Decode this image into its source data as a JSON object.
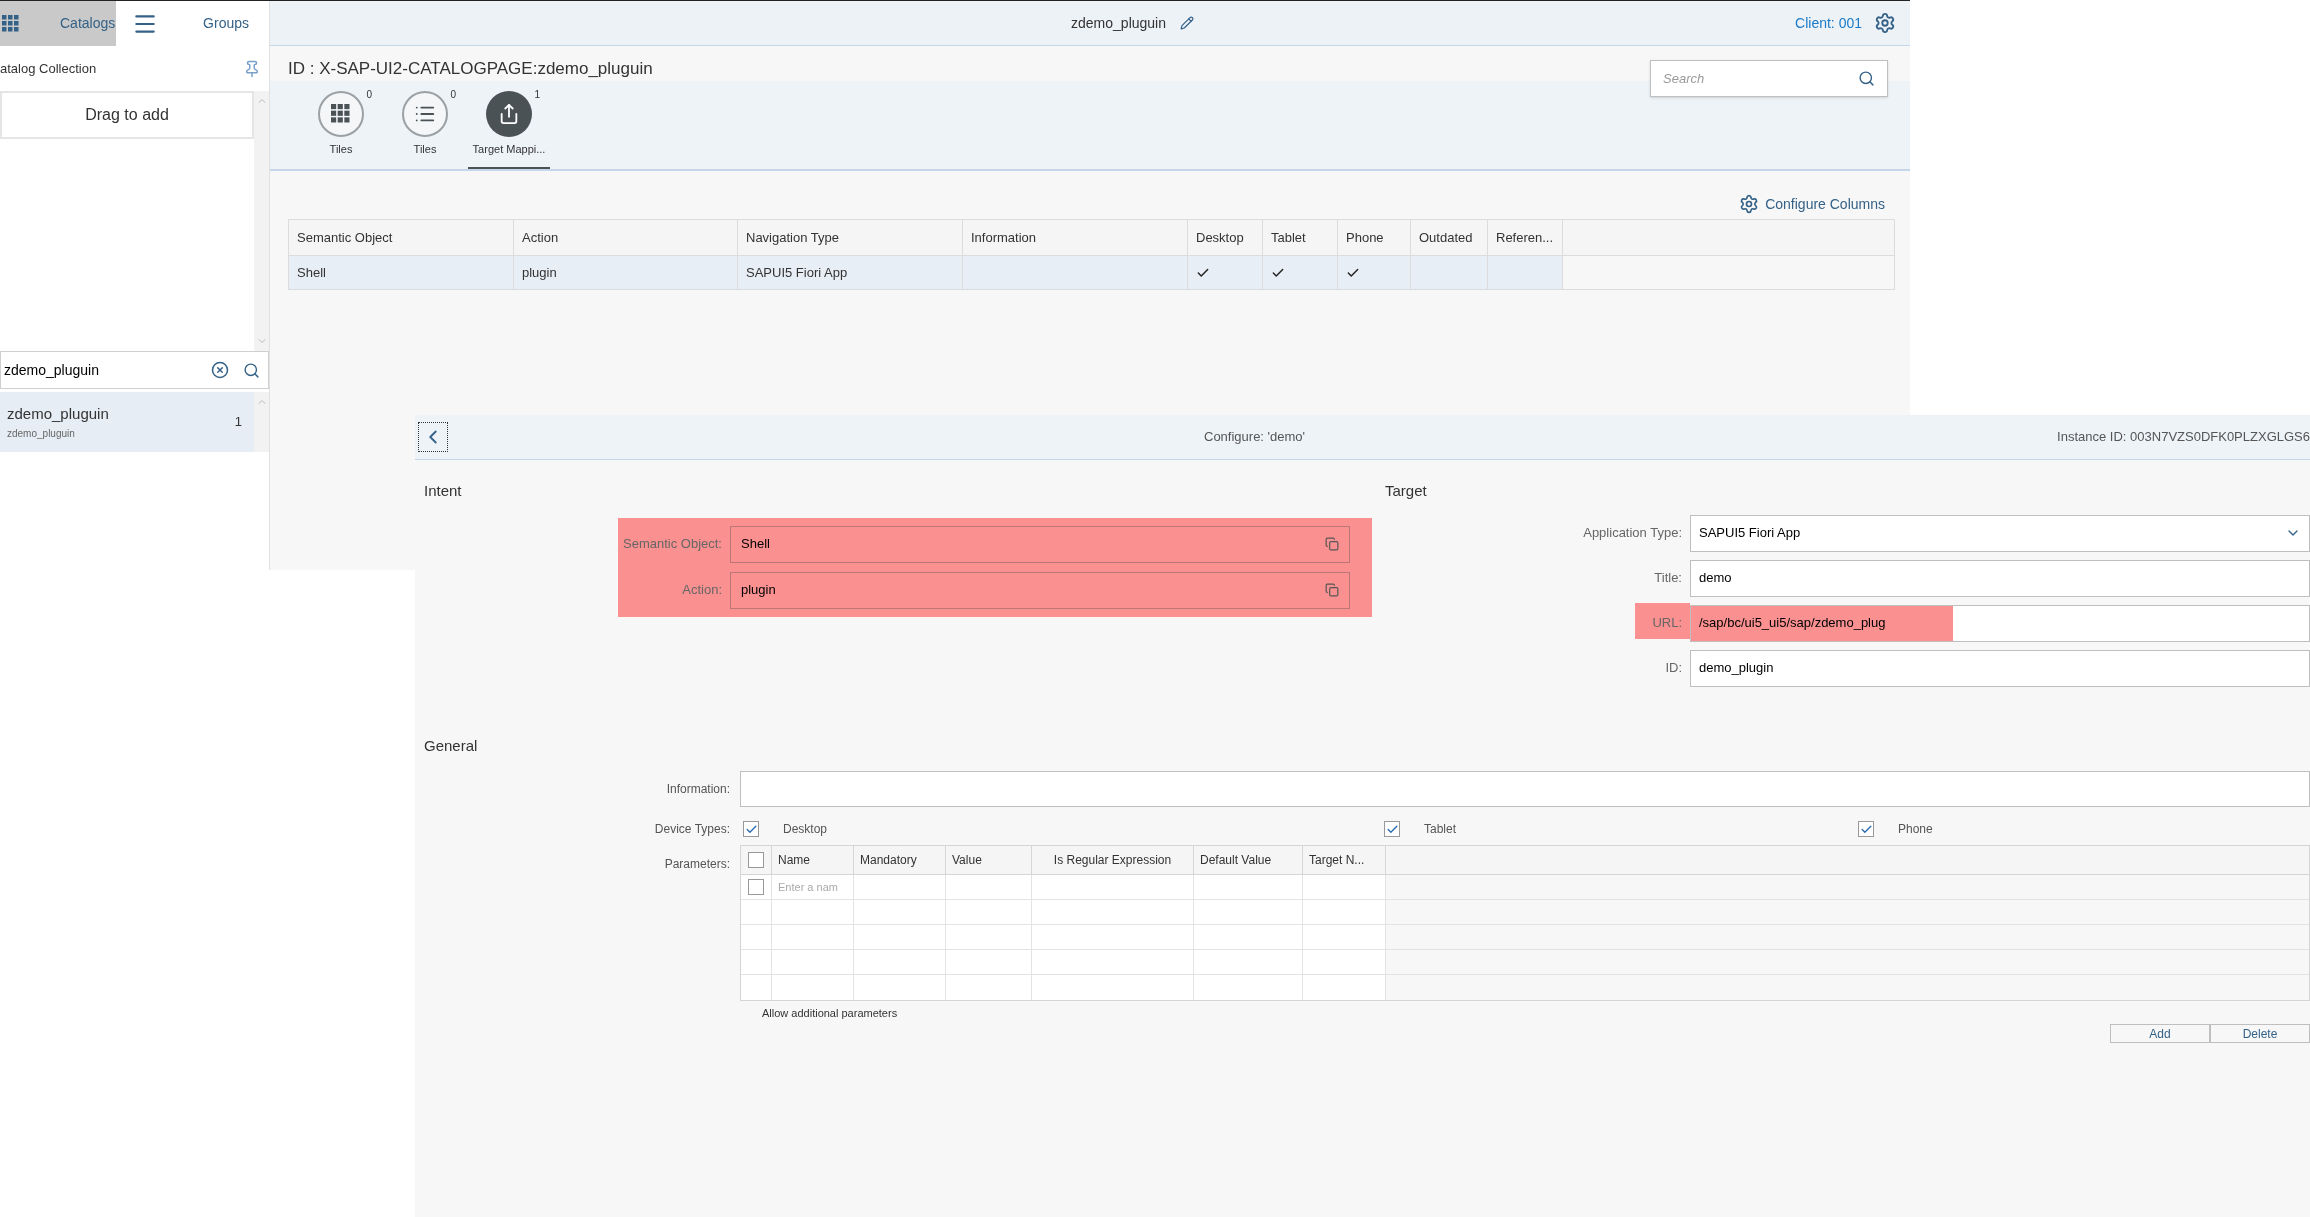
{
  "catalog_window": {
    "sidebar": {
      "tabs": [
        {
          "label": "Catalogs",
          "selected": true
        },
        {
          "label": "Groups",
          "selected": false
        }
      ],
      "collection_title": "atalog Collection",
      "drop_zone": "Drag to add",
      "search": {
        "value": "zdemo_pluguin"
      },
      "items": [
        {
          "title": "zdemo_pluguin",
          "subtitle": "zdemo_pluguin",
          "count": "1",
          "selected": true
        }
      ]
    },
    "header": {
      "title": "zdemo_pluguin",
      "client": "Client: 001"
    },
    "page_id": "ID : X-SAP-UI2-CATALOGPAGE:zdemo_pluguin",
    "search": {
      "placeholder": "Search"
    },
    "content_tabs": [
      {
        "kind": "grid",
        "label": "Tiles",
        "count": "0",
        "selected": false
      },
      {
        "kind": "list",
        "label": "Tiles",
        "count": "0",
        "selected": false
      },
      {
        "kind": "mapping",
        "label": "Target Mappi...",
        "count": "1",
        "selected": true
      }
    ],
    "configure_columns": "Configure Columns",
    "table": {
      "columns": [
        "Semantic Object",
        "Action",
        "Navigation Type",
        "Information",
        "Desktop",
        "Tablet",
        "Phone",
        "Outdated",
        "Referen..."
      ],
      "rows": [
        {
          "semantic_object": "Shell",
          "action": "plugin",
          "navigation_type": "SAPUI5 Fiori App",
          "desktop": true,
          "tablet": true,
          "phone": true,
          "selected": true
        }
      ]
    }
  },
  "configure_window": {
    "title": "Configure: 'demo'",
    "instance_id": "Instance ID: 003N7VZS0DFK0PLZXGLGS6",
    "intent": {
      "heading": "Intent",
      "highlighted": true,
      "fields": [
        {
          "label": "Semantic Object:",
          "value": "Shell"
        },
        {
          "label": "Action:",
          "value": "plugin"
        }
      ]
    },
    "target": {
      "heading": "Target",
      "fields": [
        {
          "kind": "select",
          "label": "Application Type:",
          "value": "SAPUI5 Fiori App",
          "highlighted": false
        },
        {
          "kind": "text",
          "label": "Title:",
          "value": "demo",
          "highlighted": false
        },
        {
          "kind": "text",
          "label": "URL:",
          "value": "/sap/bc/ui5_ui5/sap/zdemo_plug",
          "highlighted": true
        },
        {
          "kind": "text",
          "label": "ID:",
          "value": "demo_plugin",
          "highlighted": false
        }
      ]
    },
    "general": {
      "heading": "General",
      "information": {
        "label": "Information:"
      },
      "device_types": {
        "label": "Device Types:",
        "options": [
          {
            "label": "Desktop",
            "checked": true
          },
          {
            "label": "Tablet",
            "checked": true
          },
          {
            "label": "Phone",
            "checked": true
          }
        ]
      },
      "parameters": {
        "label": "Parameters:",
        "columns": [
          "Name",
          "Mandatory",
          "Value",
          "Is Regular Expression",
          "Default Value",
          "Target N..."
        ],
        "select_all_checked": false,
        "rows": [
          {
            "checked": false
          }
        ],
        "name_placeholder": "Enter a nam"
      },
      "allow_additional": "Allow additional parameters",
      "buttons": [
        "Add",
        "Delete"
      ]
    }
  }
}
